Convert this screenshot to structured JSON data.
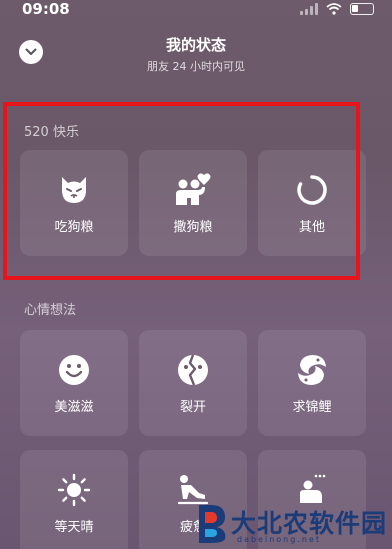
{
  "status_bar": {
    "time": "09:08",
    "icons": [
      "signal-icon",
      "wifi-icon",
      "battery-icon"
    ]
  },
  "header": {
    "title": "我的状态",
    "subtitle": "朋友 24 小时内可见",
    "back_icon": "chevron-down-icon"
  },
  "sections": [
    {
      "label": "520 快乐",
      "items": [
        {
          "label": "吃狗粮",
          "icon": "dog-face-icon"
        },
        {
          "label": "撒狗粮",
          "icon": "couple-heart-icon"
        },
        {
          "label": "其他",
          "icon": "loading-ring-icon"
        }
      ]
    },
    {
      "label": "心情想法",
      "items": [
        {
          "label": "美滋滋",
          "icon": "smiley-icon"
        },
        {
          "label": "裂开",
          "icon": "cracked-face-icon"
        },
        {
          "label": "求锦鲤",
          "icon": "koi-fish-icon"
        },
        {
          "label": "等天晴",
          "icon": "sun-icon"
        },
        {
          "label": "疲惫",
          "icon": "tired-person-icon"
        },
        {
          "label": "",
          "icon": "sleeping-person-icon"
        }
      ]
    }
  ],
  "highlight": {
    "color": "#e8141c"
  },
  "watermark": {
    "text": "大北农软件园",
    "domain": "dabeinong.net",
    "color": "#1b3c78"
  }
}
